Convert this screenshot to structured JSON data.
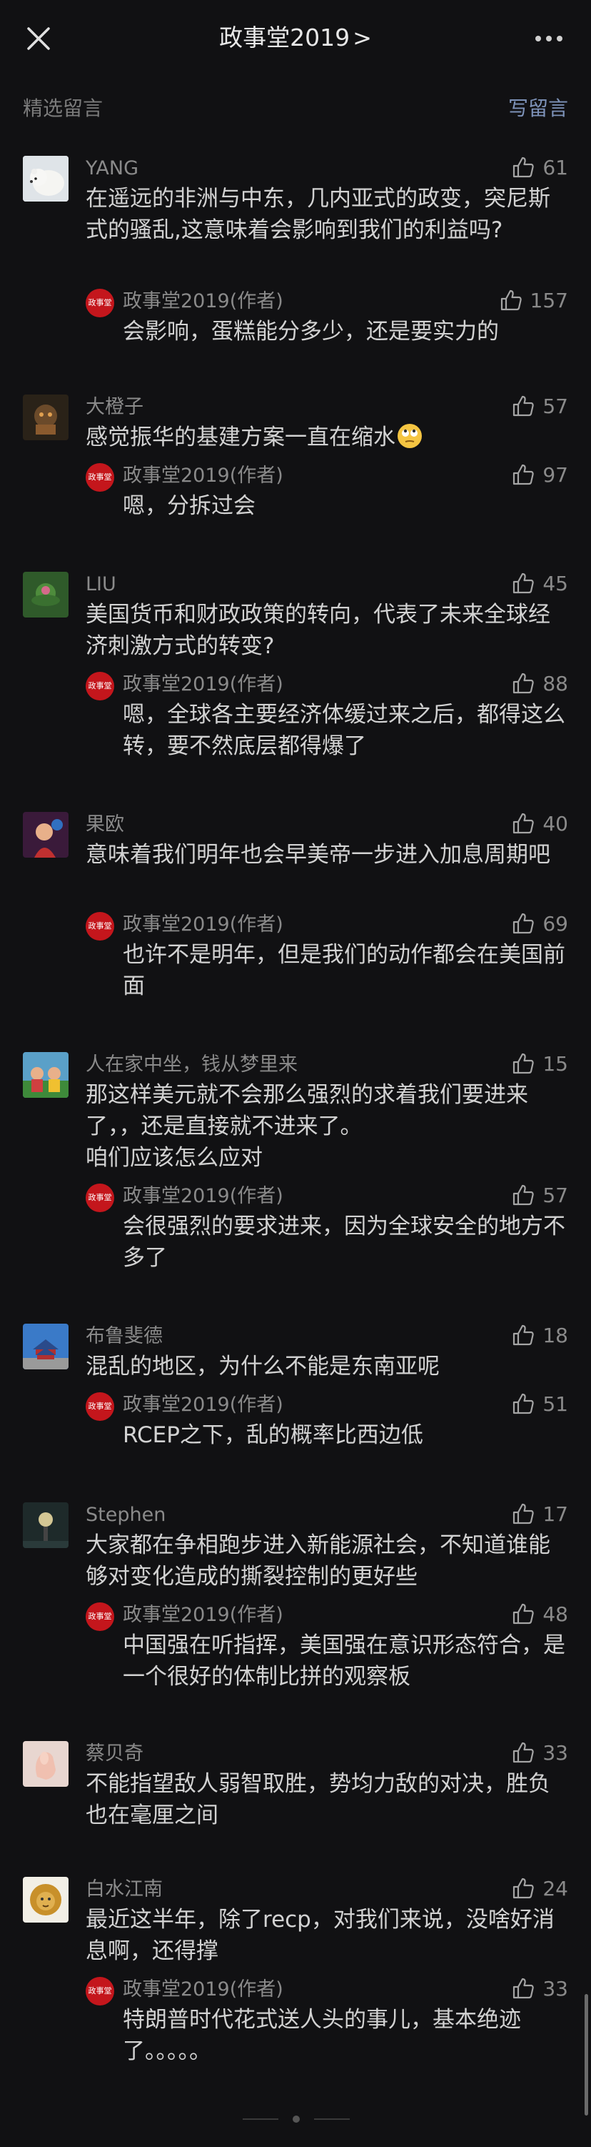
{
  "header": {
    "title": "政事堂2019",
    "title_chevron": ">"
  },
  "section": {
    "label": "精选留言",
    "write_label": "写留言"
  },
  "comments": [
    {
      "user": "YANG",
      "likes": "61",
      "text": "在遥远的非洲与中东，几内亚式的政变，突尼斯式的骚乱,这意味着会影响到我们的利益吗?",
      "reply": {
        "author": "政事堂2019(作者)",
        "likes": "157",
        "text": "会影响，蛋糕能分多少，还是要实力的"
      }
    },
    {
      "user": "大橙子",
      "likes": "57",
      "text": "感觉振华的基建方案一直在缩水",
      "reply": {
        "author": "政事堂2019(作者)",
        "likes": "97",
        "text": "嗯，分拆过会"
      }
    },
    {
      "user": "LIU",
      "likes": "45",
      "text": "美国货币和财政政策的转向，代表了未来全球经济刺激方式的转变?",
      "reply": {
        "author": "政事堂2019(作者)",
        "likes": "88",
        "text": "嗯，全球各主要经济体缓过来之后，都得这么转，要不然底层都得爆了"
      }
    },
    {
      "user": "果欧",
      "likes": "40",
      "text": "意味着我们明年也会早美帝一步进入加息周期吧",
      "reply": {
        "author": "政事堂2019(作者)",
        "likes": "69",
        "text": "也许不是明年，但是我们的动作都会在美国前面"
      }
    },
    {
      "user": "人在家中坐，钱从梦里来",
      "likes": "15",
      "text": "那这样美元就不会那么强烈的求着我们要进来了，，还是直接就不进来了。\n咱们应该怎么应对",
      "reply": {
        "author": "政事堂2019(作者)",
        "likes": "57",
        "text": "会很强烈的要求进来，因为全球安全的地方不多了"
      }
    },
    {
      "user": "布鲁斐德",
      "likes": "18",
      "text": "混乱的地区，为什么不能是东南亚呢",
      "reply": {
        "author": "政事堂2019(作者)",
        "likes": "51",
        "text": "RCEP之下，乱的概率比西边低"
      }
    },
    {
      "user": "Stephen",
      "likes": "17",
      "text": "大家都在争相跑步进入新能源社会，不知道谁能够对变化造成的撕裂控制的更好些",
      "reply": {
        "author": "政事堂2019(作者)",
        "likes": "48",
        "text": "中国强在听指挥，美国强在意识形态符合，是一个很好的体制比拼的观察板"
      }
    },
    {
      "user": "蔡贝奇",
      "likes": "33",
      "text": "不能指望敌人弱智取胜，势均力敌的对决，胜负也在毫厘之间"
    },
    {
      "user": "白水江南",
      "likes": "24",
      "text": "最近这半年，除了recp，对我们来说，没啥好消息啊，还得撑",
      "reply": {
        "author": "政事堂2019(作者)",
        "likes": "33",
        "text": "特朗普时代花式送人头的事儿，基本绝迹了。。。。。"
      }
    }
  ],
  "author_avatar_text": "政事堂"
}
